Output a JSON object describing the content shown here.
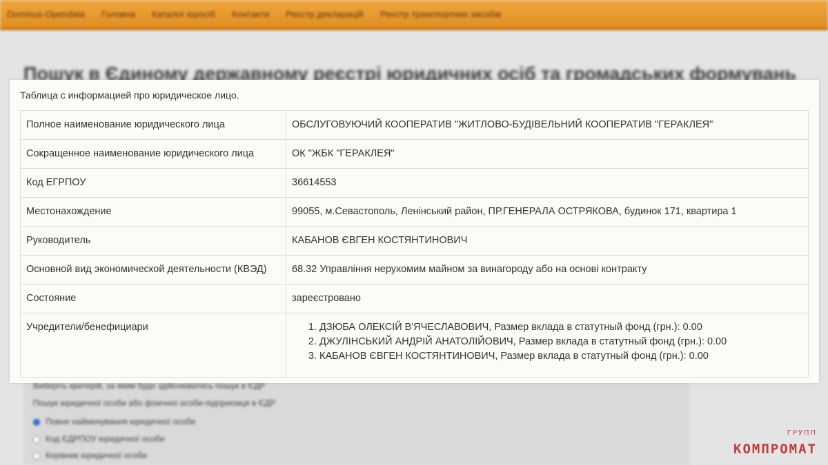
{
  "background": {
    "nav": [
      "Dominus-Opendata",
      "Головна",
      "Каталог юросіб",
      "Контакти",
      "Реєстр декларацій",
      "Реєстр транспортних засобів"
    ],
    "heading": "Пошук в Єдиному державному реєстрі юридичних осіб та громадських формувань",
    "form_lines": [
      "Виберіть критерій, за яким буде здійснюватись пошук в ЄДР",
      "Пошук юридичної особи або фізичної особи-підприємця в ЄДР",
      "Повне найменування юридичної особи",
      "Код ЄДРПОУ юридичної особи",
      "Керівник юридичної особи"
    ]
  },
  "panel": {
    "caption": "Таблица с информацией про юридическое лицо.",
    "rows": [
      {
        "key": "Полное наименование юридического лица",
        "value": "ОБСЛУГОВУЮЧИЙ КООПЕРАТИВ \"ЖИТЛОВО-БУДІВЕЛЬНИЙ КООПЕРАТИВ \"ГЕРАКЛЕЯ\""
      },
      {
        "key": "Сокращенное наименование юридического лица",
        "value": "ОК \"ЖБК \"ГЕРАКЛЕЯ\""
      },
      {
        "key": "Код ЕГРПОУ",
        "value": "36614553"
      },
      {
        "key": "Местонахождение",
        "value": "99055, м.Севастополь, Ленінський район, ПР.ГЕНЕРАЛА ОСТРЯКОВА, будинок 171, квартира 1"
      },
      {
        "key": "Руководитель",
        "value": "КАБАНОВ ЄВГЕН КОСТЯНТИНОВИЧ"
      },
      {
        "key": "Основной вид экономической деятельности (КВЭД)",
        "value": "68.32 Управління нерухомим майном за винагороду або на основі контракту"
      },
      {
        "key": "Состояние",
        "value": "зареєстровано"
      }
    ],
    "founders_key": "Учредители/бенефициари",
    "founders": [
      "ДЗЮБА ОЛЕКСІЙ В'ЯЧЕСЛАВОВИЧ, Размер вклада в статутный фонд (грн.): 0.00",
      "ДЖУЛІНСЬКИЙ АНДРІЙ АНАТОЛІЙОВИЧ, Размер вклада в статутный фонд (грн.): 0.00",
      "КАБАНОВ ЄВГЕН КОСТЯНТИНОВИЧ, Размер вклада в статутный фонд (грн.): 0.00"
    ]
  },
  "watermark": {
    "small": "ГРУПП",
    "main": "КОМПРОМАТ"
  }
}
